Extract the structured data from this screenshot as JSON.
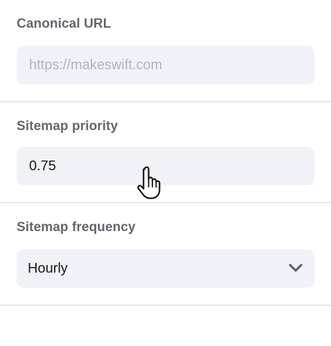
{
  "canonical": {
    "label": "Canonical URL",
    "placeholder": "https://makeswift.com",
    "value": ""
  },
  "sitemap_priority": {
    "label": "Sitemap priority",
    "value": "0.75"
  },
  "sitemap_frequency": {
    "label": "Sitemap frequency",
    "selected": "Hourly"
  },
  "icons": {
    "dropdown": "chevron-down-icon",
    "pointer": "hand-pointer-cursor"
  },
  "colors": {
    "label": "#63666c",
    "field_bg": "#f1f2f7",
    "divider": "#e6e7ea",
    "placeholder": "#b2b4bb"
  }
}
